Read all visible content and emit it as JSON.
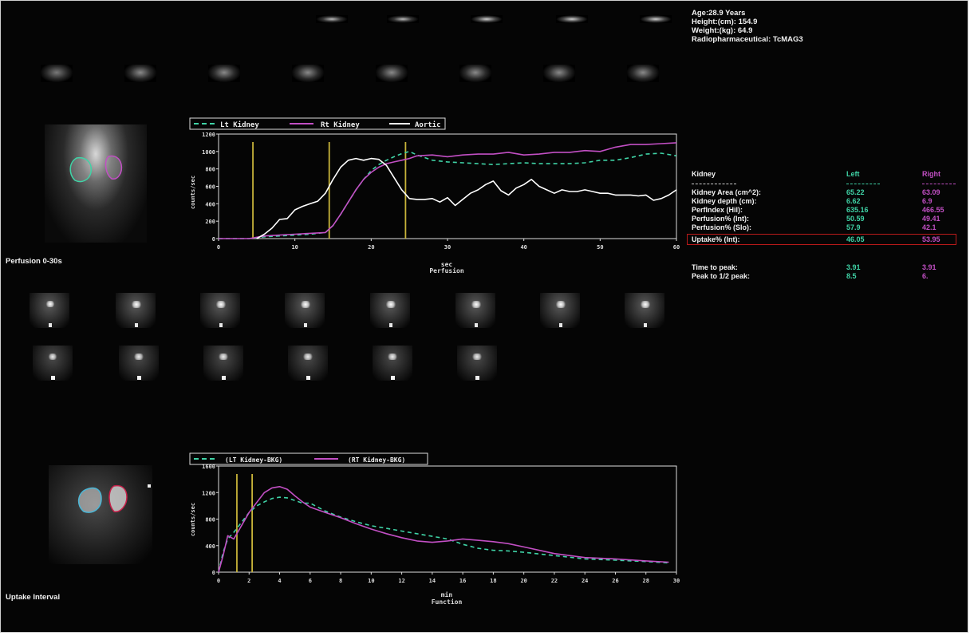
{
  "patient": {
    "age": "Age:28.9 Years",
    "height": "Height:(cm): 154.9",
    "weight": "Weight:(kg): 64.9",
    "radiopharmaceutical": "Radiopharmaceutical: TcMAG3"
  },
  "labels": {
    "perfusion_caption": "Perfusion 0-30s",
    "uptake_caption": "Uptake Interval"
  },
  "colors": {
    "left": "#3fd3a6",
    "right": "#c24fc4",
    "aortic": "#ffffff",
    "markers": "#c8b43a",
    "background": "#050505"
  },
  "table": {
    "header": {
      "label": "Kidney",
      "left": "Left",
      "right": "Right"
    },
    "rows": [
      {
        "label": "Kidney Area (cm^2):",
        "left": "65.22",
        "right": "63.09"
      },
      {
        "label": "Kidney depth (cm):",
        "left": "6.62",
        "right": "6.9"
      },
      {
        "label": "PerfIndex (Hil):",
        "left": "635.16",
        "right": "466.55"
      },
      {
        "label": "Perfusion% (Int):",
        "left": "50.59",
        "right": "49.41"
      },
      {
        "label": "Perfusion% (Slo):",
        "left": "57.9",
        "right": "42.1"
      },
      {
        "label": "Uptake% (Int):",
        "left": "46.05",
        "right": "53.95"
      }
    ],
    "timing": [
      {
        "label": "Time to peak:",
        "left": "3.91",
        "right": "3.91"
      },
      {
        "label": "Peak to 1/2 peak:",
        "left": "8.5",
        "right": "6."
      }
    ]
  },
  "chart_data": [
    {
      "type": "line",
      "name": "perfusion",
      "title": "Perfusion",
      "xlabel": "sec",
      "ylabel": "counts/sec",
      "xlim": [
        0,
        60
      ],
      "ylim": [
        0,
        1200
      ],
      "xticks": [
        "0",
        "10",
        "20",
        "30",
        "40",
        "50",
        "60"
      ],
      "yticks": [
        "0",
        "200",
        "400",
        "600",
        "800",
        "1000",
        "1200"
      ],
      "markers": [
        4.5,
        14.5,
        24.5
      ],
      "legend": [
        "Lt Kidney",
        "Rt Kidney",
        "Aortic"
      ],
      "series": [
        {
          "name": "Lt Kidney",
          "style": "dashed",
          "color": "#3fd3a6",
          "x": [
            0,
            4,
            6,
            8,
            10,
            12,
            13,
            14,
            15,
            16,
            17,
            18,
            19,
            20,
            21,
            22,
            23,
            24,
            25,
            26,
            28,
            30,
            32,
            34,
            36,
            38,
            40,
            42,
            44,
            46,
            48,
            50,
            52,
            54,
            56,
            58,
            60
          ],
          "y": [
            0,
            0,
            20,
            30,
            40,
            50,
            60,
            70,
            150,
            280,
            420,
            560,
            680,
            780,
            850,
            900,
            940,
            975,
            1000,
            960,
            900,
            880,
            870,
            860,
            850,
            860,
            870,
            860,
            860,
            860,
            870,
            900,
            900,
            930,
            970,
            980,
            950
          ]
        },
        {
          "name": "Rt Kidney",
          "style": "solid",
          "color": "#c24fc4",
          "x": [
            0,
            4,
            6,
            8,
            10,
            12,
            14,
            15,
            16,
            17,
            18,
            19,
            20,
            21,
            22,
            23,
            24,
            25,
            26,
            28,
            30,
            32,
            34,
            36,
            38,
            40,
            42,
            44,
            46,
            48,
            50,
            52,
            54,
            56,
            58,
            60
          ],
          "y": [
            0,
            0,
            30,
            40,
            50,
            60,
            70,
            150,
            280,
            420,
            560,
            680,
            760,
            820,
            860,
            880,
            900,
            920,
            950,
            960,
            940,
            960,
            970,
            970,
            990,
            960,
            970,
            990,
            990,
            1010,
            1000,
            1050,
            1080,
            1080,
            1090,
            1100
          ]
        },
        {
          "name": "Aortic",
          "style": "solid",
          "color": "#ffffff",
          "x": [
            5,
            6,
            7,
            8,
            9,
            10,
            11,
            12,
            13,
            14,
            15,
            16,
            17,
            18,
            19,
            20,
            21,
            22,
            23,
            24,
            25,
            26,
            27,
            28,
            29,
            30,
            31,
            32,
            33,
            34,
            35,
            36,
            37,
            38,
            39,
            40,
            41,
            42,
            43,
            44,
            45,
            46,
            47,
            48,
            49,
            50,
            51,
            52,
            53,
            54,
            55,
            56,
            57,
            58,
            59,
            60
          ],
          "y": [
            0,
            50,
            120,
            220,
            230,
            330,
            370,
            400,
            430,
            520,
            680,
            820,
            900,
            920,
            900,
            920,
            910,
            840,
            700,
            560,
            460,
            450,
            450,
            460,
            420,
            470,
            380,
            450,
            520,
            560,
            620,
            660,
            550,
            500,
            580,
            620,
            680,
            600,
            560,
            520,
            560,
            540,
            540,
            560,
            540,
            520,
            520,
            500,
            500,
            500,
            490,
            500,
            440,
            460,
            500,
            560
          ]
        }
      ]
    },
    {
      "type": "line",
      "name": "function",
      "title": "Function",
      "xlabel": "min",
      "ylabel": "counts/sec",
      "xlim": [
        0,
        30
      ],
      "ylim": [
        0,
        1600
      ],
      "xticks": [
        "0",
        "2",
        "4",
        "6",
        "8",
        "10",
        "12",
        "14",
        "16",
        "18",
        "20",
        "22",
        "24",
        "26",
        "28",
        "30"
      ],
      "yticks": [
        "0",
        "400",
        "800",
        "1200",
        "1600"
      ],
      "markers": [
        1.2,
        2.2
      ],
      "legend": [
        "(LT Kidney-BKG)",
        "(RT Kidney-BKG)"
      ],
      "series": [
        {
          "name": "(LT Kidney-BKG)",
          "style": "dashed",
          "color": "#3fd3a6",
          "x": [
            0,
            0.3,
            0.6,
            1,
            1.5,
            2,
            2.5,
            3,
            3.5,
            4,
            4.5,
            5,
            5.5,
            6,
            7,
            8,
            9,
            10,
            11,
            12,
            13,
            14,
            15,
            16,
            17,
            18,
            19,
            20,
            22,
            24,
            26,
            28,
            29.5
          ],
          "y": [
            0,
            300,
            500,
            600,
            750,
            900,
            1000,
            1060,
            1110,
            1130,
            1120,
            1080,
            1040,
            1040,
            920,
            830,
            760,
            700,
            660,
            620,
            580,
            540,
            500,
            420,
            360,
            330,
            320,
            300,
            250,
            200,
            180,
            160,
            140
          ]
        },
        {
          "name": "(RT Kidney-BKG)",
          "style": "solid",
          "color": "#c24fc4",
          "x": [
            0,
            0.3,
            0.6,
            1,
            1.5,
            2,
            2.5,
            3,
            3.5,
            4,
            4.5,
            5,
            5.5,
            6,
            7,
            8,
            9,
            10,
            11,
            12,
            13,
            14,
            15,
            16,
            17,
            18,
            19,
            20,
            22,
            24,
            26,
            28,
            29.5
          ],
          "y": [
            0,
            250,
            550,
            500,
            700,
            900,
            1050,
            1200,
            1270,
            1290,
            1250,
            1150,
            1060,
            980,
            900,
            820,
            730,
            650,
            580,
            520,
            470,
            450,
            470,
            500,
            480,
            460,
            430,
            380,
            280,
            220,
            200,
            170,
            150
          ]
        }
      ]
    }
  ]
}
